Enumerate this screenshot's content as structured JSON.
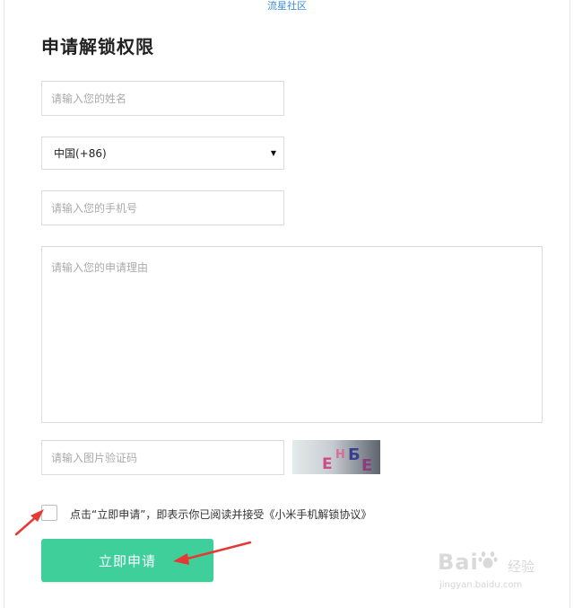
{
  "watermark_top": "流星社区",
  "form": {
    "title": "申请解锁权限",
    "name_placeholder": "请输入您的姓名",
    "country_code": "中国(+86)",
    "phone_placeholder": "请输入您的手机号",
    "reason_placeholder": "请输入您的申请理由",
    "captcha_placeholder": "请输入图片验证码",
    "captcha_text": [
      "E",
      "H",
      "Б",
      "E"
    ],
    "agreement_text": "点击“立即申请”，即表示你已阅读并接受《小米手机解锁协议》",
    "submit_label": "立即申请"
  },
  "watermark_brand": {
    "main": "Bai",
    "cn": "经验",
    "sub": "jingyan.baidu.com"
  },
  "colors": {
    "accent": "#3fcf9b",
    "annotation": "#e53935",
    "watermark_link": "#3c8dde"
  }
}
